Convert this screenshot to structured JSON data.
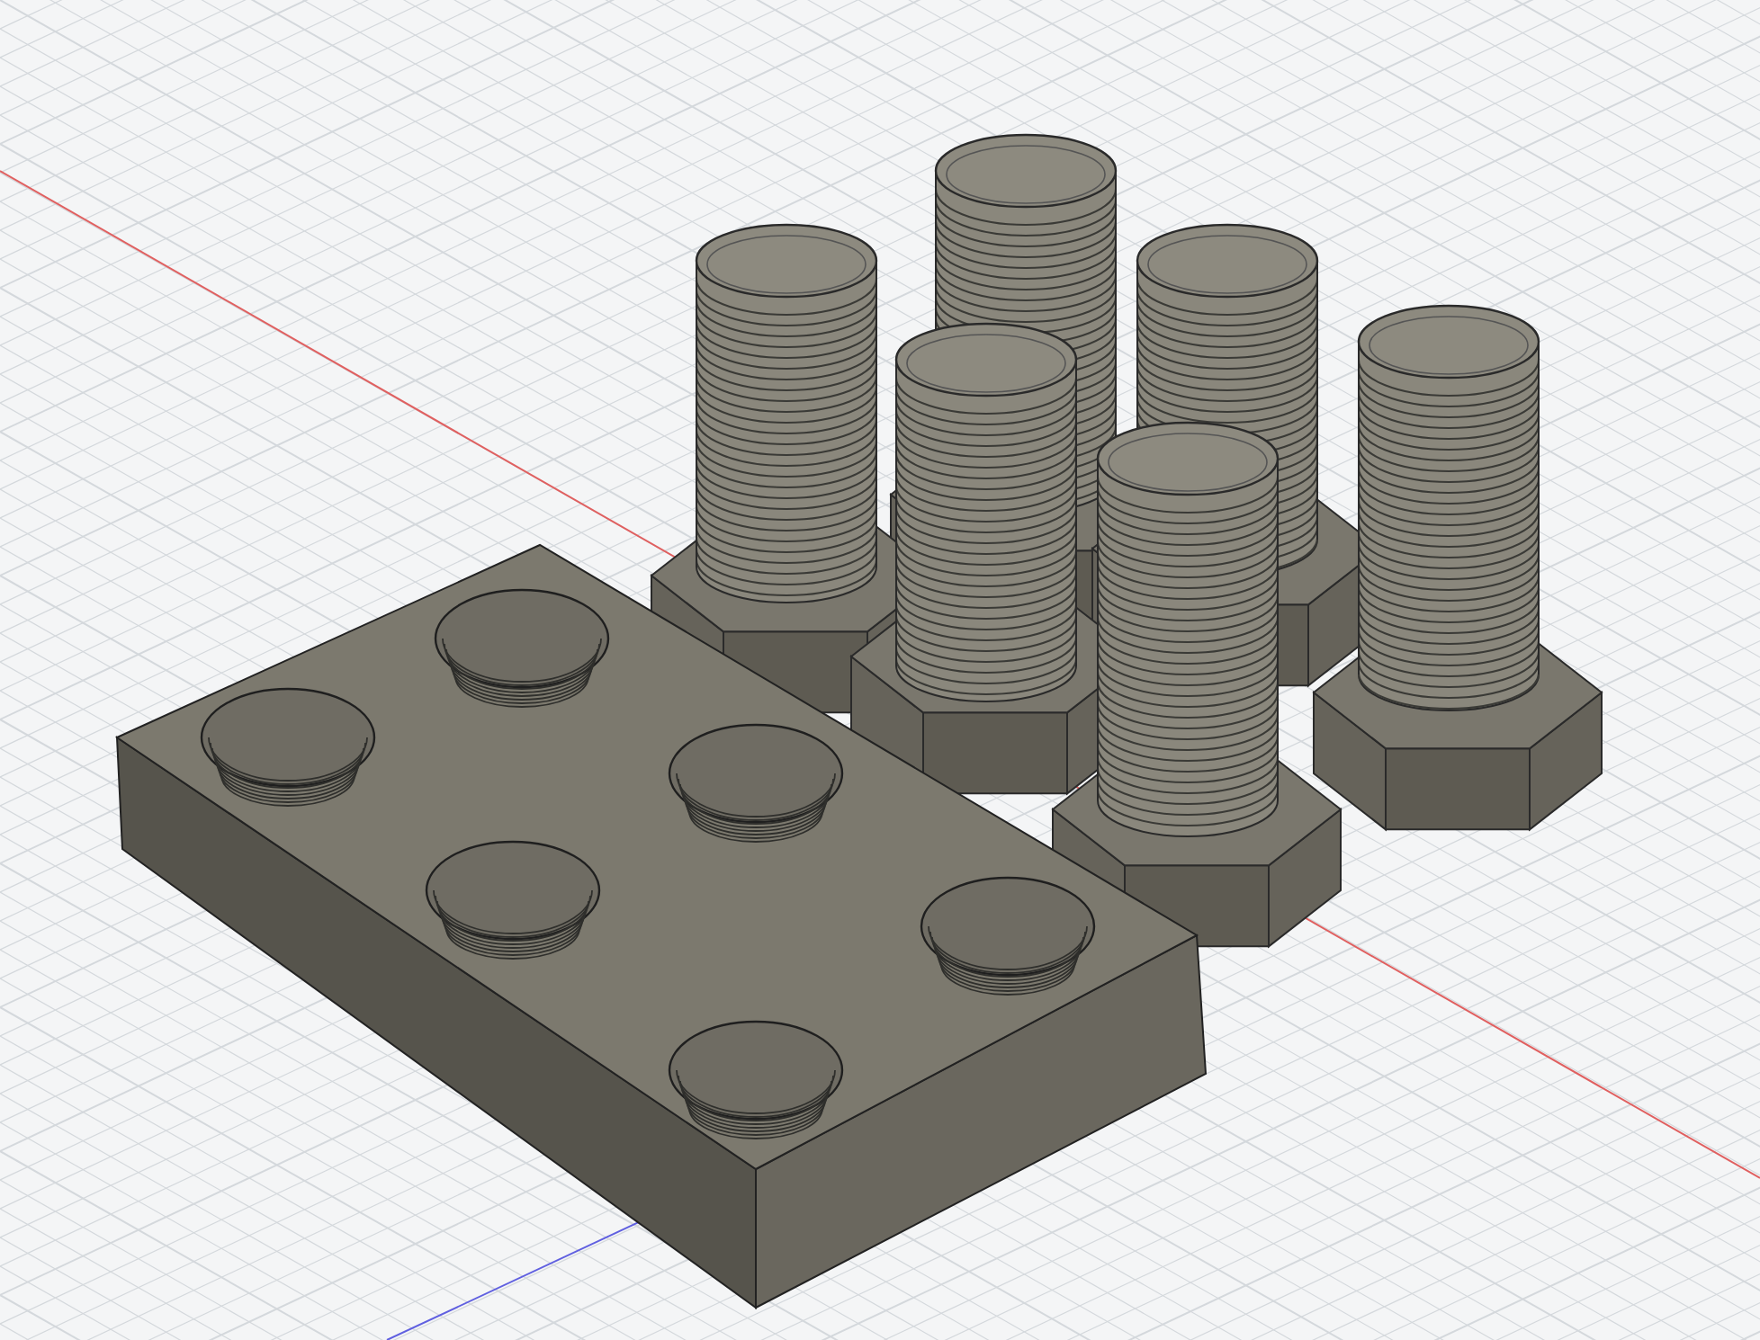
{
  "scene": {
    "objects": [
      {
        "kind": "bolt"
      },
      {
        "kind": "bolt"
      },
      {
        "kind": "bolt"
      },
      {
        "kind": "bolt"
      },
      {
        "kind": "bolt"
      },
      {
        "kind": "bolt"
      },
      {
        "kind": "plate"
      }
    ]
  }
}
